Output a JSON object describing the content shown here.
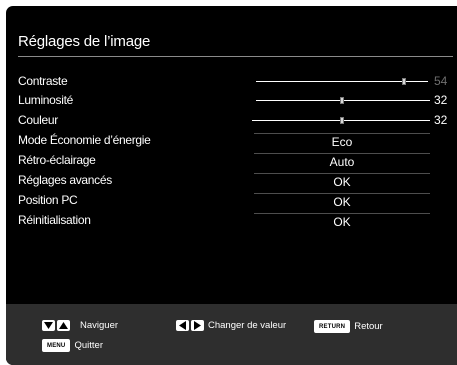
{
  "title": "Réglages de l’image",
  "settings": [
    {
      "label": "Contraste",
      "type": "slider",
      "value": "54",
      "dim": true,
      "level": 0.93
    },
    {
      "label": "Luminosité",
      "type": "slider",
      "value": "32",
      "dim": false,
      "level": 0.52
    },
    {
      "label": "Couleur",
      "type": "slider",
      "value": "32",
      "dim": false,
      "level": 0.52
    },
    {
      "label": "Mode Économie d’énergie",
      "type": "option",
      "value": "Eco"
    },
    {
      "label": "Rétro-éclairage",
      "type": "option",
      "value": "Auto"
    },
    {
      "label": "Réglages avancés",
      "type": "option",
      "value": "OK"
    },
    {
      "label": "Position PC",
      "type": "option",
      "value": "OK"
    },
    {
      "label": "Réinitialisation",
      "type": "option",
      "value": "OK"
    }
  ],
  "footer": {
    "navigate": "Naviguer",
    "change": "Changer de valeur",
    "back": "Retour",
    "back_key": "RETURN",
    "quit": "Quitter",
    "quit_key": "MENU"
  },
  "icons": {
    "navigate": "up-down-arrows-icon",
    "change": "left-right-arrows-icon"
  }
}
